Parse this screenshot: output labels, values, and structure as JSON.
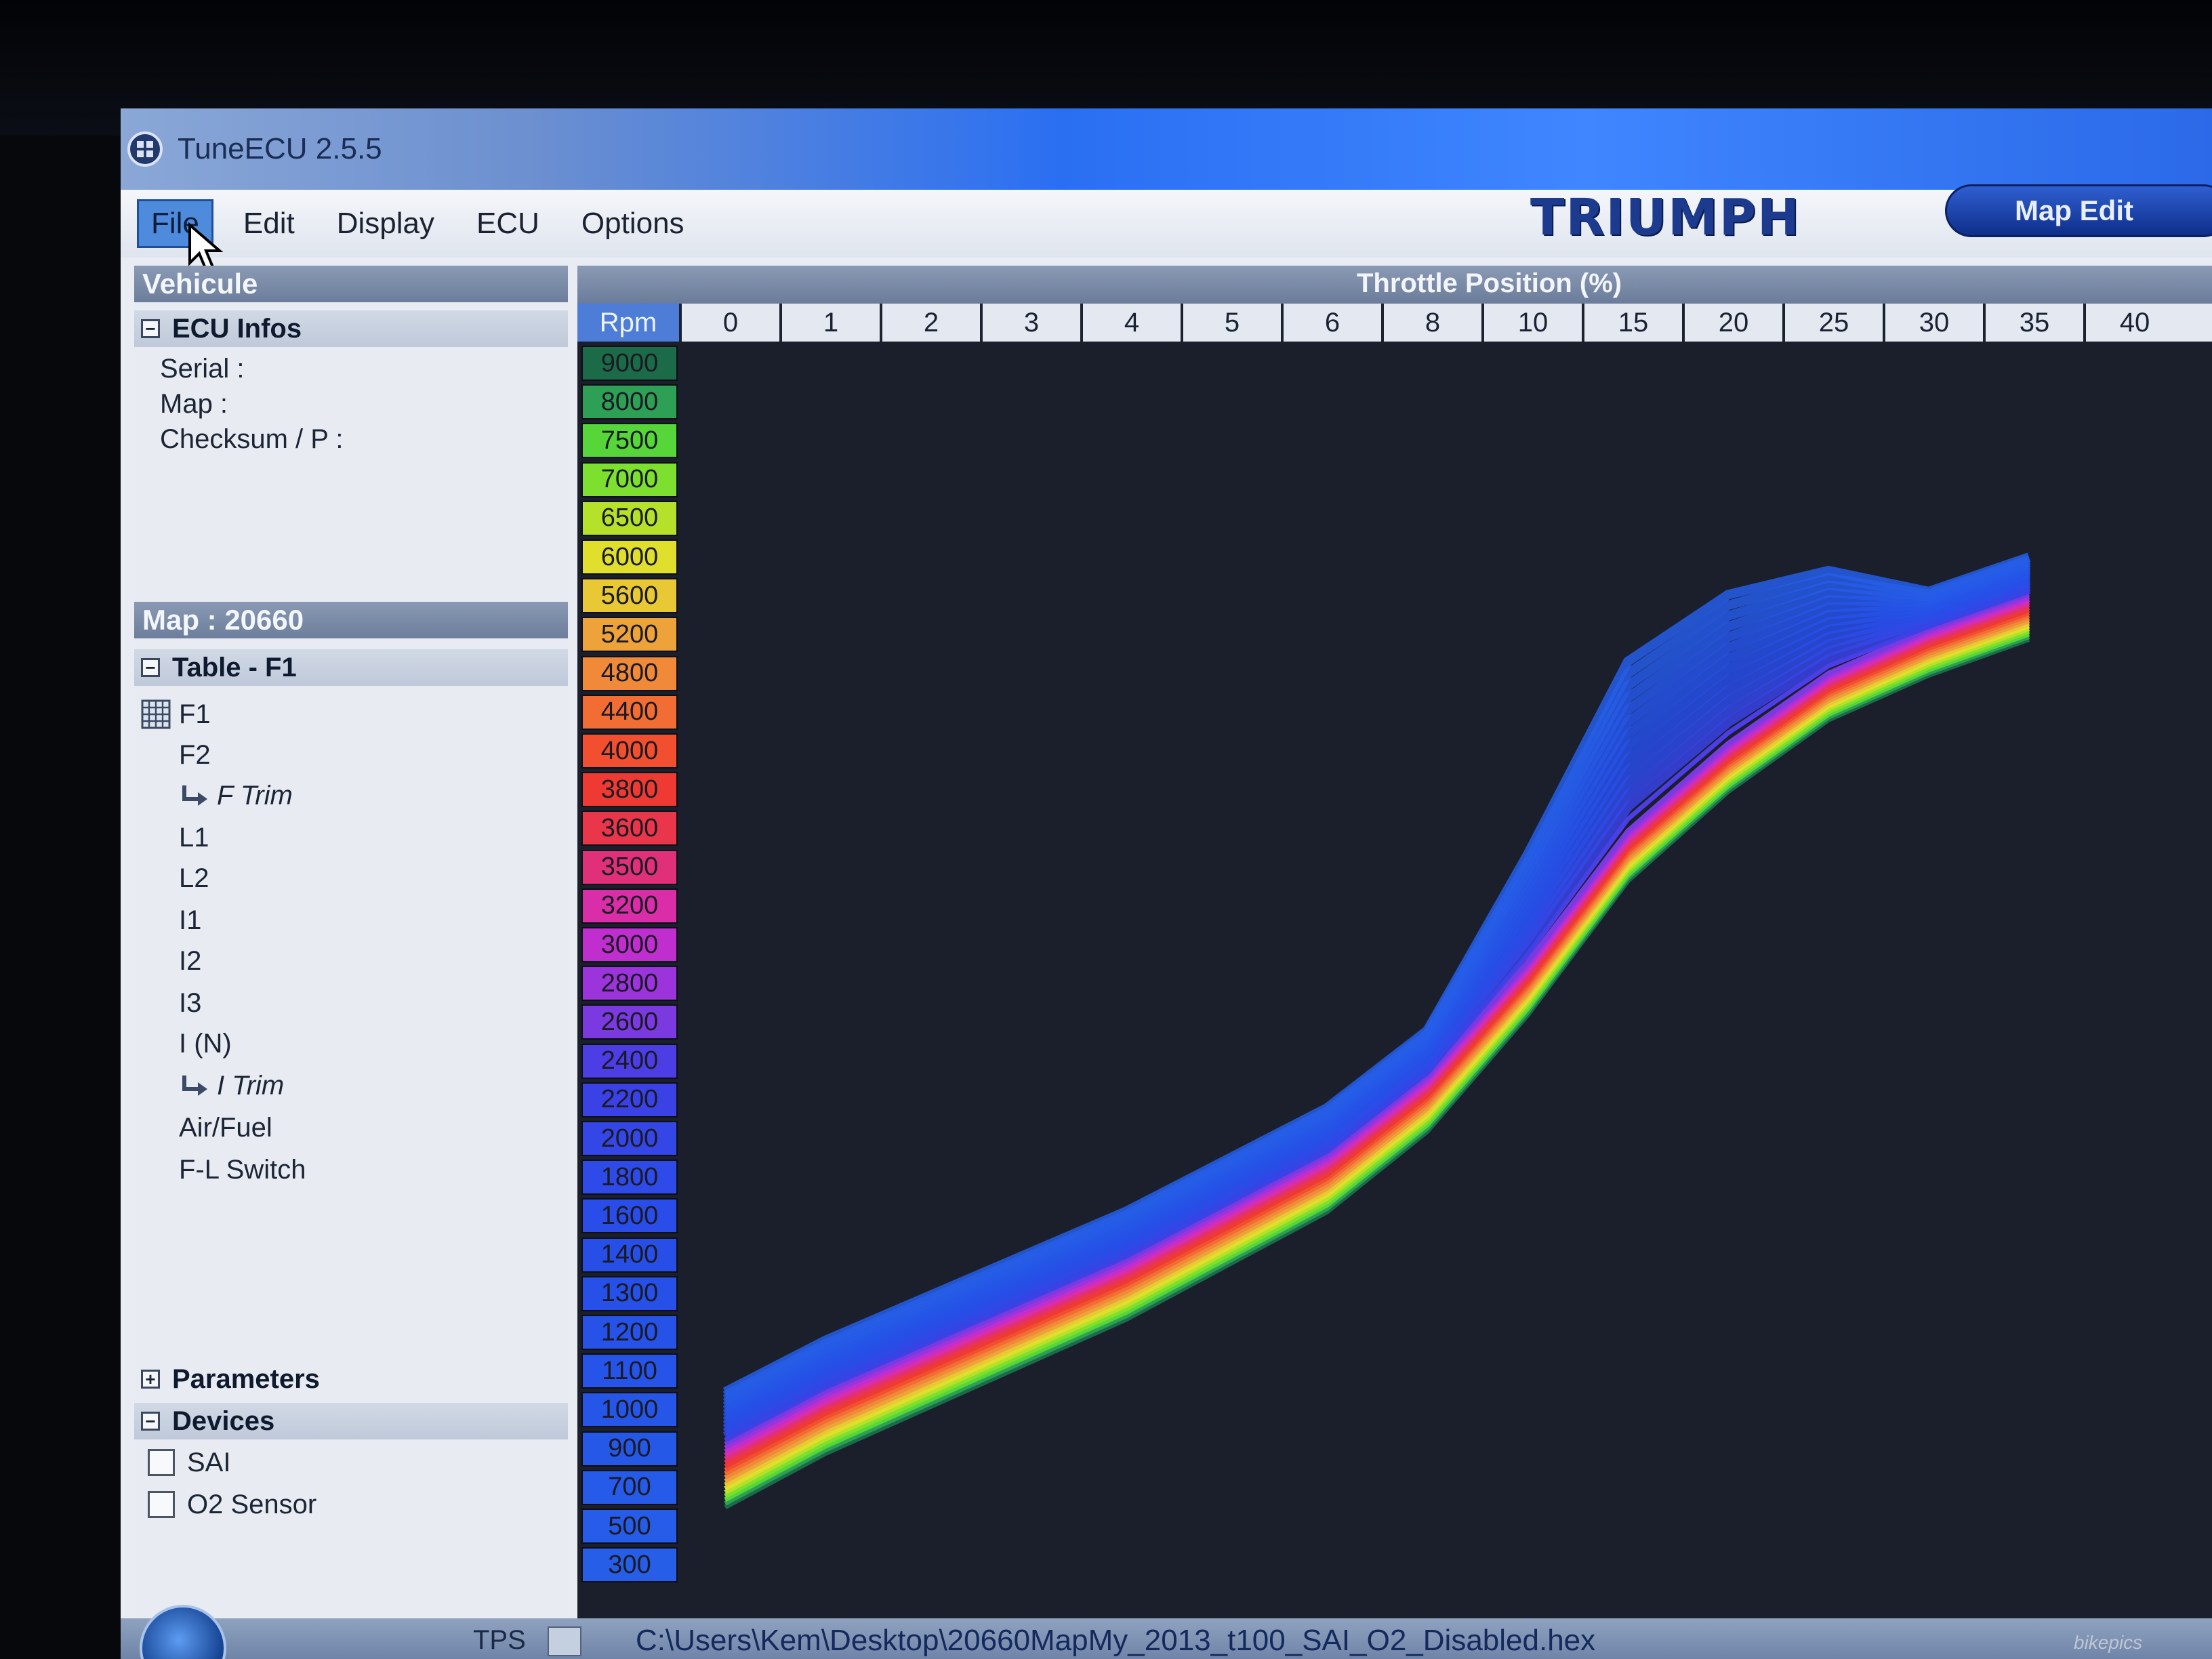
{
  "window": {
    "title": "TuneECU 2.5.5"
  },
  "menu": [
    "File",
    "Edit",
    "Display",
    "ECU",
    "Options"
  ],
  "brand": {
    "logo_text": "TRIUMPH",
    "map_edit_label": "Map Edit"
  },
  "left_panel": {
    "vehicule_title": "Vehicule",
    "ecu_infos": {
      "header": "ECU Infos",
      "rows": [
        "Serial :",
        "Map :",
        "Checksum / P :"
      ]
    },
    "map_title": "Map : 20660",
    "table": {
      "header": "Table - F1",
      "items": [
        "F1",
        "F2",
        "F Trim",
        "L1",
        "L2",
        "I1",
        "I2",
        "I3",
        "I (N)",
        "I Trim",
        "Air/Fuel",
        "F-L Switch"
      ]
    },
    "parameters_header": "Parameters",
    "devices": {
      "header": "Devices",
      "items": [
        {
          "label": "SAI",
          "checked": false
        },
        {
          "label": "O2 Sensor",
          "checked": false
        }
      ]
    }
  },
  "chart_data": {
    "type": "line",
    "title": "Throttle Position (%)",
    "row_axis_label": "Rpm",
    "x": [
      0,
      1,
      2,
      3,
      4,
      5,
      6,
      8,
      10,
      15,
      20,
      25,
      30,
      35,
      40
    ],
    "series": [
      {
        "rpm": "9000",
        "color": "#1c6b48"
      },
      {
        "rpm": "8000",
        "color": "#2da055"
      },
      {
        "rpm": "7500",
        "color": "#57d63a"
      },
      {
        "rpm": "7000",
        "color": "#7ee02e"
      },
      {
        "rpm": "6500",
        "color": "#b6e12a"
      },
      {
        "rpm": "6000",
        "color": "#e0e02c"
      },
      {
        "rpm": "5600",
        "color": "#e8c834"
      },
      {
        "rpm": "5200",
        "color": "#eea33a"
      },
      {
        "rpm": "4800",
        "color": "#f08a38"
      },
      {
        "rpm": "4400",
        "color": "#f26d34"
      },
      {
        "rpm": "4000",
        "color": "#f14f30"
      },
      {
        "rpm": "3800",
        "color": "#ee3a32"
      },
      {
        "rpm": "3600",
        "color": "#e9364a"
      },
      {
        "rpm": "3500",
        "color": "#e1307a"
      },
      {
        "rpm": "3200",
        "color": "#d92ea8"
      },
      {
        "rpm": "3000",
        "color": "#c12ed0"
      },
      {
        "rpm": "2800",
        "color": "#9c34dc"
      },
      {
        "rpm": "2600",
        "color": "#7a3ae0"
      },
      {
        "rpm": "2400",
        "color": "#4c3ee4"
      },
      {
        "rpm": "2200",
        "color": "#3a42e6"
      },
      {
        "rpm": "2000",
        "color": "#3446e6"
      },
      {
        "rpm": "1800",
        "color": "#2e4ae8"
      },
      {
        "rpm": "1600",
        "color": "#2a4ce8"
      },
      {
        "rpm": "1400",
        "color": "#284ee8"
      },
      {
        "rpm": "1300",
        "color": "#2650e8"
      },
      {
        "rpm": "1200",
        "color": "#2652e8"
      },
      {
        "rpm": "1100",
        "color": "#2654e8"
      },
      {
        "rpm": "1000",
        "color": "#2656e8"
      },
      {
        "rpm": "900",
        "color": "#2658e8"
      },
      {
        "rpm": "700",
        "color": "#265ae8"
      },
      {
        "rpm": "500",
        "color": "#265ce8"
      },
      {
        "rpm": "300",
        "color": "#265ee8"
      }
    ]
  },
  "status": {
    "tps_label": "TPS",
    "file_path": "C:\\Users\\Kem\\Desktop\\20660MapMy_2013_t100_SAI_O2_Disabled.hex"
  },
  "watermark": "bikepics"
}
